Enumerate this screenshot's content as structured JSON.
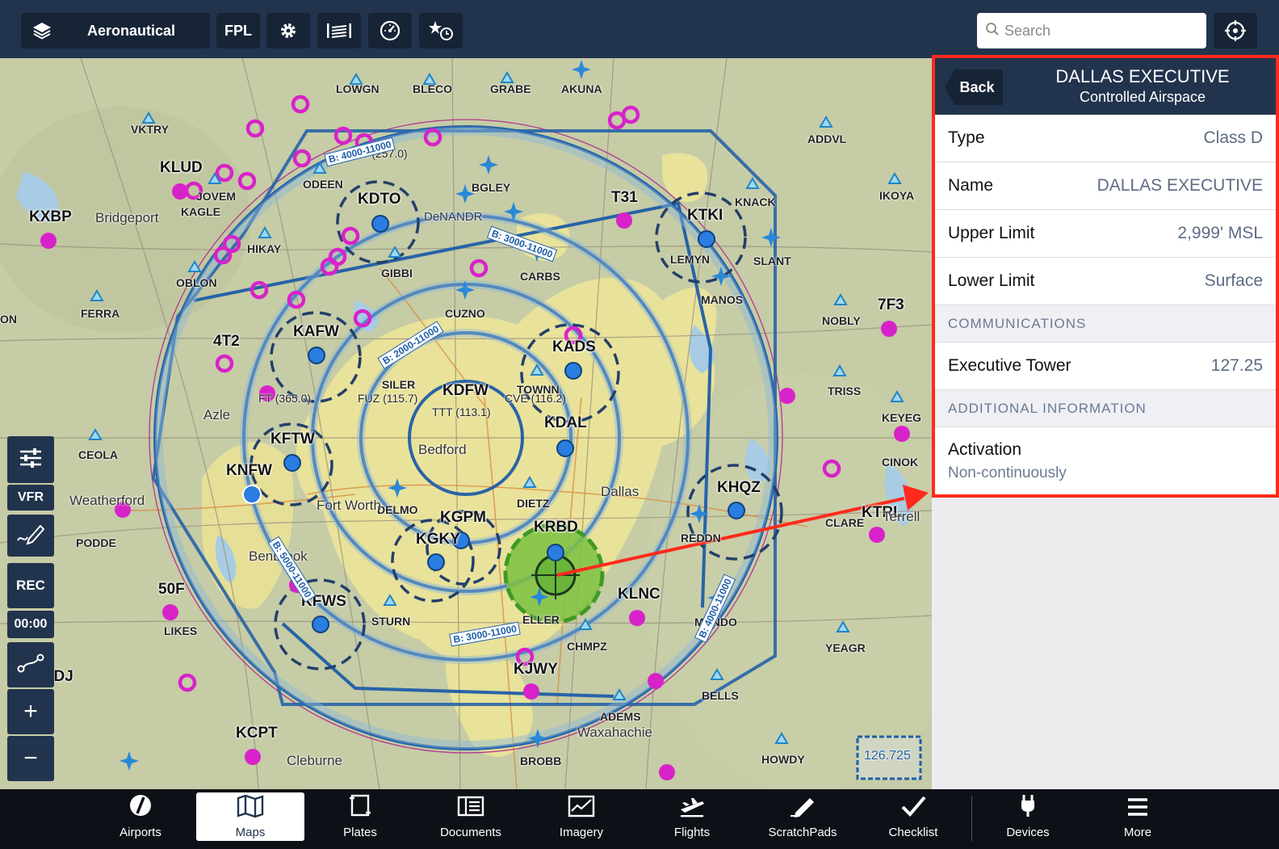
{
  "toolbar": {
    "layers_label": "Aeronautical",
    "fpl_label": "FPL",
    "search_placeholder": "Search"
  },
  "map": {
    "map_labels": [
      "LOWGN",
      "BLECO",
      "GRABE",
      "AKUNA",
      "VKTRY",
      "ADDVL",
      "IKOYA",
      "ODEEN",
      "BGLEY",
      "KNACK",
      "KAGLE",
      "HIKAY",
      "GIBBI",
      "CARBS",
      "SLANT",
      "OBLON",
      "LEMYN",
      "MANOS",
      "FERRA",
      "CUZNO",
      "NOBLY",
      "SILER",
      "TRISS",
      "KEYEG",
      "CINOK",
      "CEOLA",
      "DELMO",
      "DIETZ",
      "PODDE",
      "CLARE",
      "REDDN",
      "STURN",
      "ELLER",
      "MNNDO",
      "CHMPZ",
      "YEAGR",
      "LIKES",
      "BELLS",
      "ADEMS",
      "BROBB",
      "HOWDY",
      "JOVEM",
      "TOWNN",
      "ON"
    ],
    "airports": [
      "KLUD",
      "KXBP",
      "KDTO",
      "T31",
      "KTKI",
      "KAFW",
      "4T2",
      "KADS",
      "7F3",
      "KDFW",
      "KDAL",
      "KFTW",
      "KNFW",
      "KHQZ",
      "KGPM",
      "KRBD",
      "KTRL",
      "KGKY",
      "KLNC",
      "50F",
      "KFWS",
      "KJWY",
      "KGDJ",
      "KCPT"
    ],
    "cities": [
      "Bridgeport",
      "DeNANDR",
      "Azle",
      "Bedford",
      "Dallas",
      "Weatherford",
      "Fort Worth",
      "Benbrook",
      "Waxahachie",
      "Cleburne",
      "Terrell"
    ],
    "navaids": [
      "DT (257.0)",
      "FT (365.0)",
      "FUZ (115.7)",
      "TTT (113.1)",
      "CVE (116.2)"
    ],
    "airspace_tags": [
      "B: 4000-11000",
      "B: 3000-11000",
      "B: 2000-11000",
      "B: 3000-11000",
      "B: 5000-11000",
      "B: 4000-11000"
    ],
    "freq_box": "126.725"
  },
  "left_controls": {
    "vfr_label": "VFR",
    "rec_label": "REC",
    "timer": "00:00"
  },
  "panel": {
    "back_label": "Back",
    "title": "DALLAS EXECUTIVE",
    "subtitle": "Controlled Airspace",
    "rows": [
      {
        "key": "Type",
        "value": "Class D"
      },
      {
        "key": "Name",
        "value": "DALLAS EXECUTIVE"
      },
      {
        "key": "Upper Limit",
        "value": "2,999' MSL"
      },
      {
        "key": "Lower Limit",
        "value": "Surface"
      }
    ],
    "section_comms": "COMMUNICATIONS",
    "comm_row": {
      "key": "Executive Tower",
      "value": "127.25"
    },
    "section_info": "ADDITIONAL INFORMATION",
    "activation": {
      "key": "Activation",
      "value": "Non-continuously"
    }
  },
  "tabs": [
    {
      "label": "Airports",
      "icon": "airport-icon"
    },
    {
      "label": "Maps",
      "icon": "map-icon"
    },
    {
      "label": "Plates",
      "icon": "plates-icon"
    },
    {
      "label": "Documents",
      "icon": "documents-icon"
    },
    {
      "label": "Imagery",
      "icon": "imagery-icon"
    },
    {
      "label": "Flights",
      "icon": "flights-icon"
    },
    {
      "label": "ScratchPads",
      "icon": "scratchpad-icon"
    },
    {
      "label": "Checklist",
      "icon": "checklist-icon"
    },
    {
      "label": "Devices",
      "icon": "devices-icon"
    },
    {
      "label": "More",
      "icon": "more-icon"
    }
  ],
  "colors": {
    "toolbar": "#22344d",
    "highlight_red": "#ff2a1c",
    "class_b": "#1f5ea8",
    "class_d": "#7dc142",
    "map_yellow": "#e8e39a"
  }
}
